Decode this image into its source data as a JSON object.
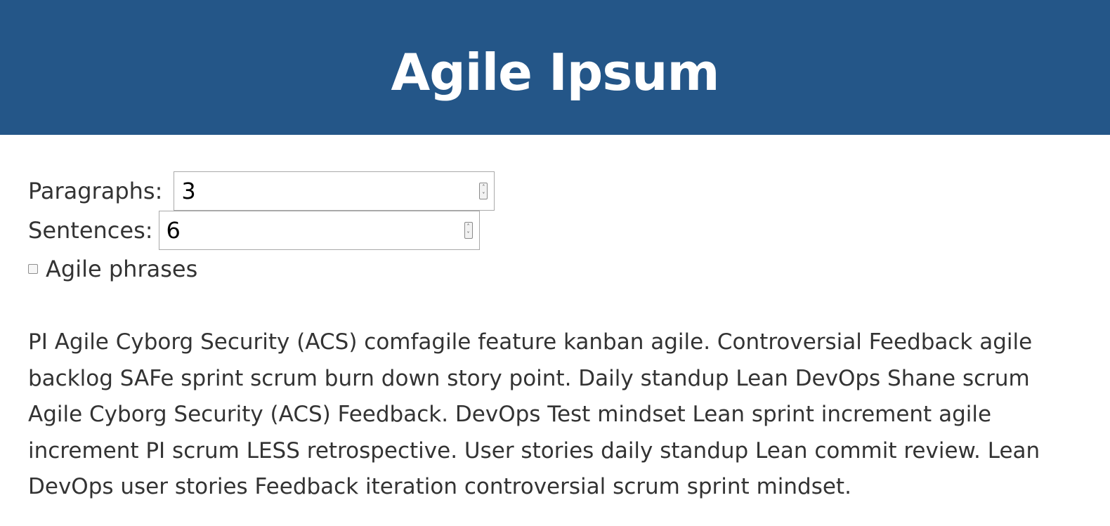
{
  "header": {
    "title": "Agile Ipsum",
    "background_color": "#245688"
  },
  "form": {
    "paragraphs": {
      "label": "Paragraphs:",
      "value": "3"
    },
    "sentences": {
      "label": "Sentences:",
      "value": "6"
    },
    "agile_phrases": {
      "label": "Agile phrases",
      "checked": false
    }
  },
  "output": {
    "paragraph_1": "PI Agile Cyborg Security (ACS) comfagile feature kanban agile. Controversial Feedback agile backlog SAFe sprint scrum burn down story point. Daily standup Lean DevOps Shane scrum Agile Cyborg Security (ACS) Feedback. DevOps Test mindset Lean sprint increment agile increment PI scrum LESS retrospective. User stories daily standup Lean commit review. Lean DevOps user stories Feedback iteration controversial scrum sprint mindset."
  }
}
